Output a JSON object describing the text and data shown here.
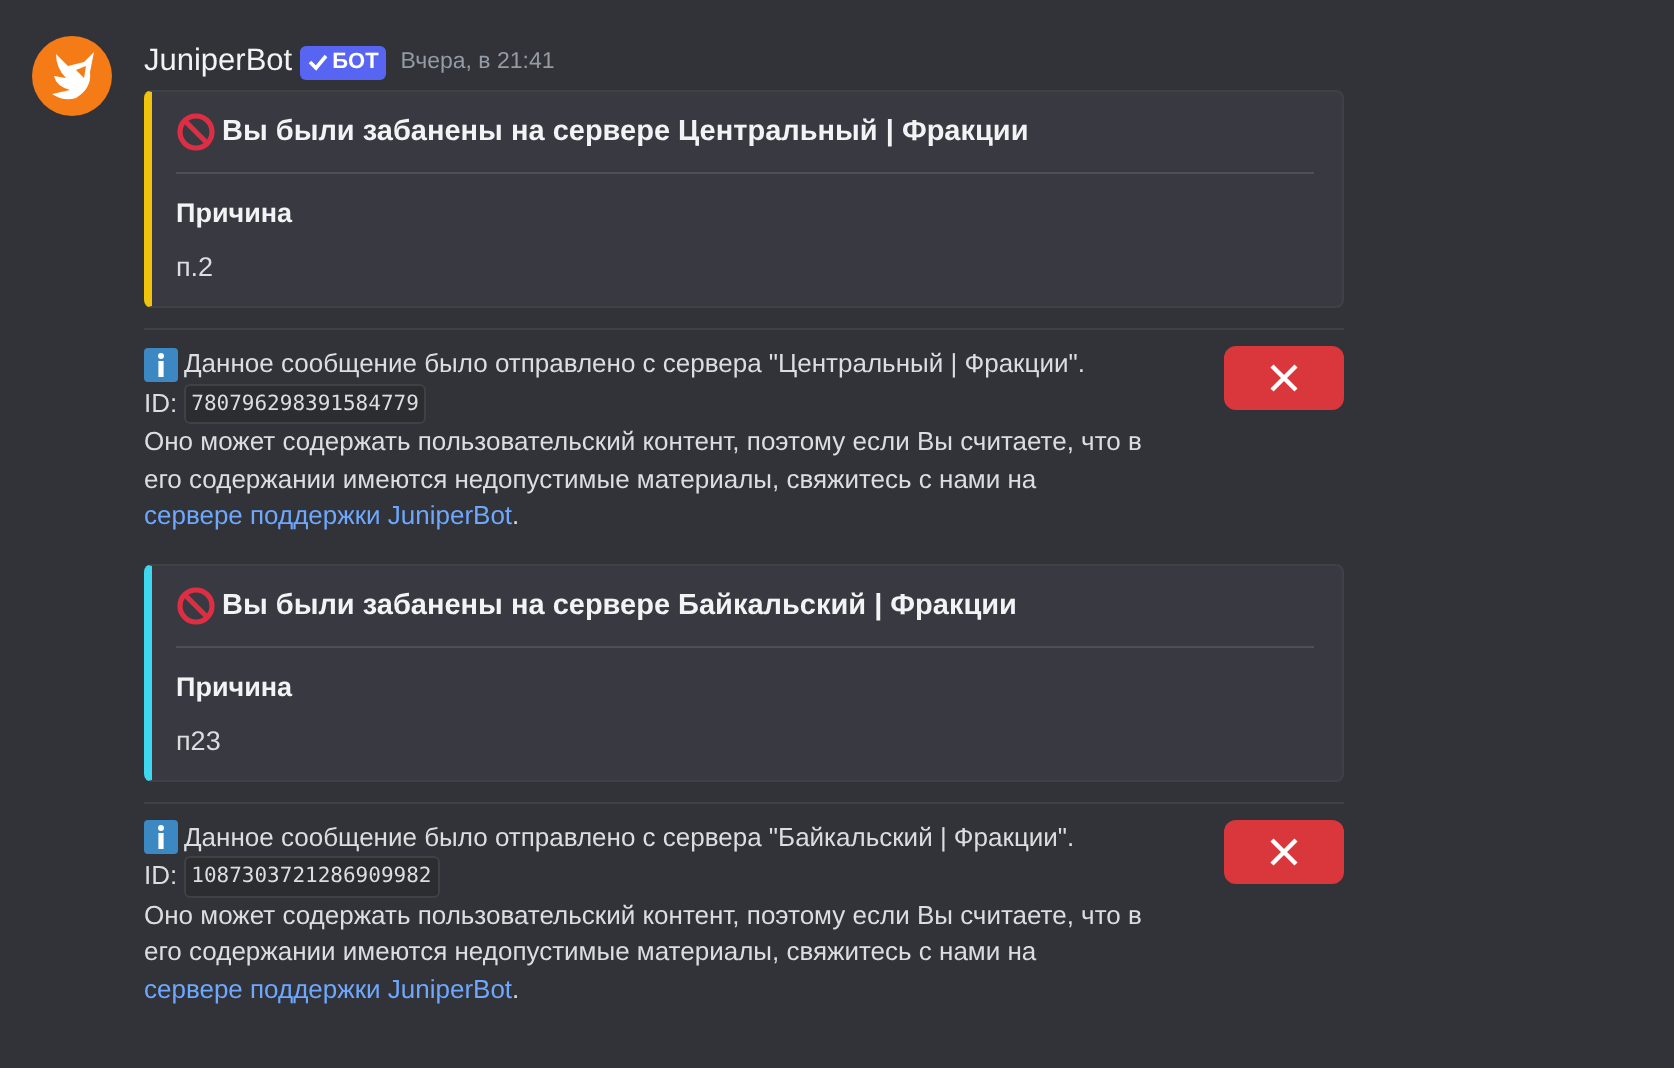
{
  "message": {
    "author": "JuniperBot",
    "badge": {
      "text": "БОТ",
      "verified": true
    },
    "timestamp": "Вчера, в 21:41"
  },
  "blocks": [
    {
      "embed": {
        "color": "#f0c30c",
        "title": "Вы были забанены на сервере Центральный | Фракции",
        "field_name": "Причина",
        "field_value": "п.2"
      },
      "notice": {
        "text": "Данное сообщение было отправлено с сервера \"Центральный | Фракции\".",
        "id_label": "ID:",
        "id": "780796298391584779",
        "body": "Оно может содержать пользовательский контент, поэтому если Вы считаете, что в его содержании имеются недопустимые материалы, свяжитесь с нами на",
        "link": "сервере поддержки JuniperBot",
        "tail": "."
      }
    },
    {
      "embed": {
        "color": "#3fd7f0",
        "title": "Вы были забанены на сервере Байкальский | Фракции",
        "field_name": "Причина",
        "field_value": "п23"
      },
      "notice": {
        "text": "Данное сообщение было отправлено с сервера \"Байкальский | Фракции\".",
        "id_label": "ID:",
        "id": "1087303721286909982",
        "body": "Оно может содержать пользовательский контент, поэтому если Вы считаете, что в его содержании имеются недопустимые материалы, свяжитесь с нами на",
        "link": "сервере поддержки JuniperBot",
        "tail": "."
      }
    }
  ]
}
